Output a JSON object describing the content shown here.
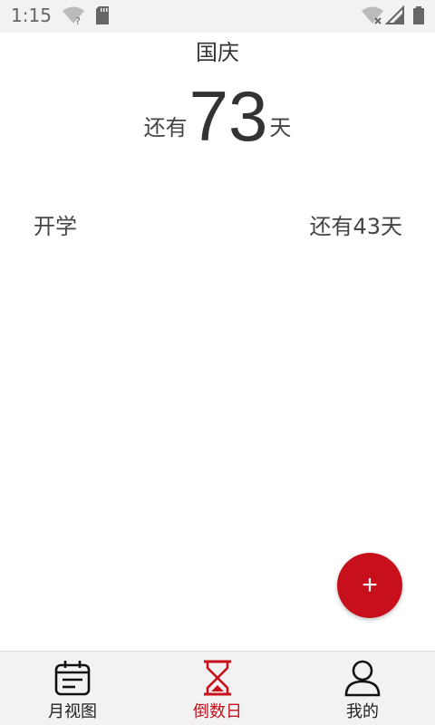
{
  "status_bar": {
    "time": "1:15",
    "icons": [
      "wifi-question-icon",
      "sd-card-icon",
      "wifi-off-icon",
      "signal-icon",
      "battery-icon"
    ]
  },
  "hero": {
    "title": "国庆",
    "prefix": "还有",
    "days": "73",
    "suffix": "天"
  },
  "events": [
    {
      "name": "开学",
      "remaining": "还有43天"
    }
  ],
  "fab": {
    "icon": "add-icon",
    "label": "+"
  },
  "bottom_nav": {
    "items": [
      {
        "label": "月视图",
        "icon": "calendar-icon",
        "active": false
      },
      {
        "label": "倒数日",
        "icon": "hourglass-icon",
        "active": true
      },
      {
        "label": "我的",
        "icon": "person-icon",
        "active": false
      }
    ]
  },
  "colors": {
    "accent": "#c8101c",
    "text": "#333333",
    "nav_background": "#f2f2f2"
  }
}
